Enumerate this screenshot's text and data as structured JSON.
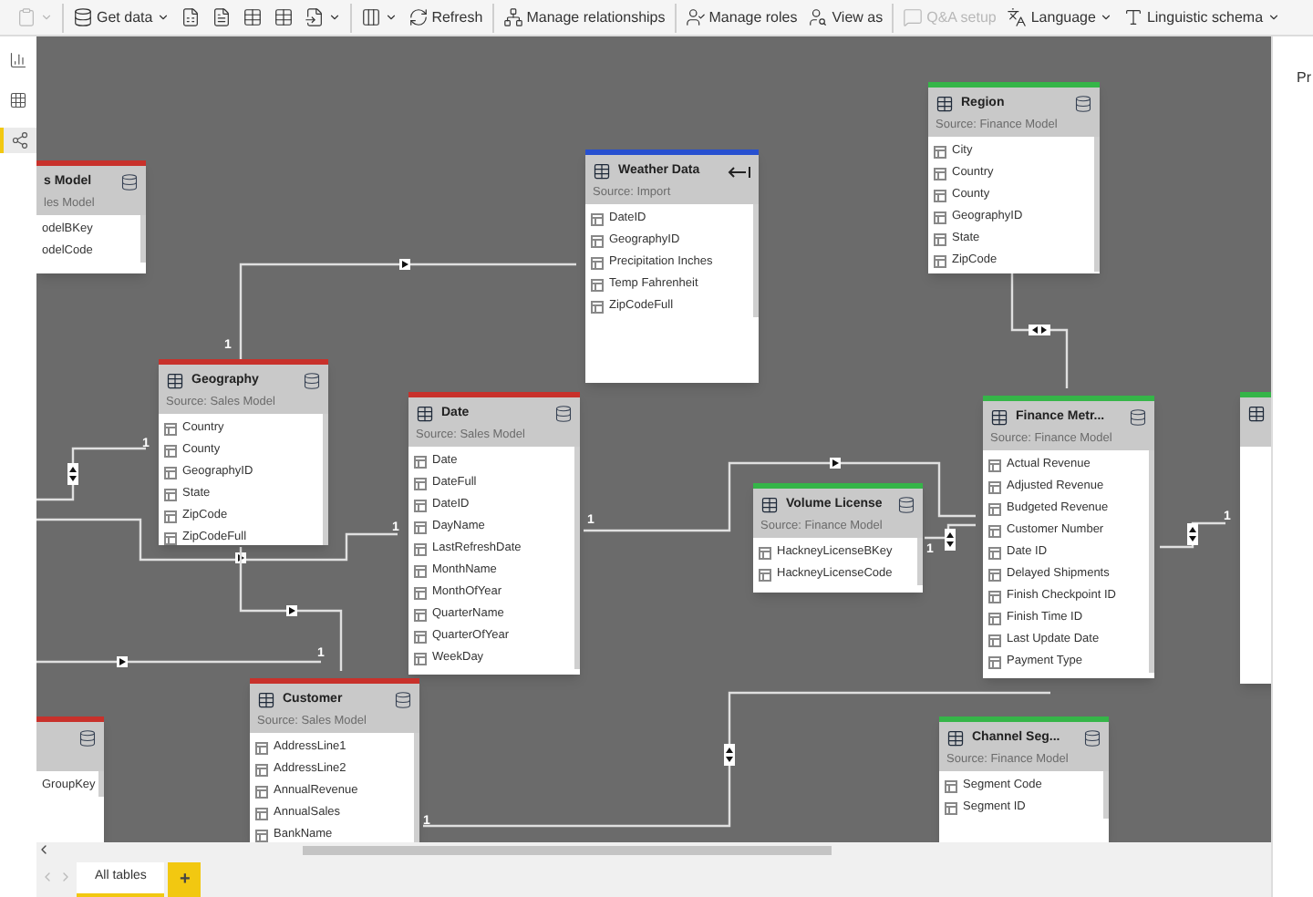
{
  "toolbar": {
    "groups": [
      [
        {
          "kind": "icon",
          "disabled": true,
          "menu": true
        }
      ],
      [
        {
          "kind": "text",
          "label": "Get data",
          "disabled": false,
          "menu": true
        },
        {
          "kind": "icon",
          "disabled": false,
          "menu": false
        },
        {
          "kind": "icon",
          "disabled": false,
          "menu": false
        },
        {
          "kind": "icon",
          "disabled": false,
          "menu": false
        },
        {
          "kind": "icon",
          "disabled": false,
          "menu": false
        },
        {
          "kind": "icon",
          "disabled": false,
          "menu": true
        }
      ],
      [
        {
          "kind": "icon",
          "disabled": false,
          "menu": true
        },
        {
          "kind": "text",
          "label": "Refresh",
          "disabled": false,
          "menu": false
        }
      ],
      [
        {
          "kind": "text",
          "label": "Manage relationships",
          "disabled": false,
          "menu": false
        }
      ],
      [
        {
          "kind": "text",
          "label": "Manage roles",
          "disabled": false,
          "menu": false
        },
        {
          "kind": "text",
          "label": "View as",
          "disabled": false,
          "menu": false
        }
      ],
      [
        {
          "kind": "text",
          "label": "Q&A setup",
          "disabled": true,
          "menu": false
        },
        {
          "kind": "text",
          "label": "Language",
          "disabled": false,
          "menu": true
        },
        {
          "kind": "text",
          "label": "Linguistic schema",
          "disabled": false,
          "menu": true
        }
      ]
    ]
  },
  "nav": [
    {
      "selected": false
    },
    {
      "selected": false
    },
    {
      "selected": true
    }
  ],
  "right_panel": {
    "title": "Pr"
  },
  "tables": [
    {
      "name": "s Model",
      "source": "les Model",
      "color": "#c8312b",
      "kind": "storage",
      "clipped": true,
      "rows": [
        "odelBKey",
        "odelCode"
      ]
    },
    {
      "name": "Weather Data",
      "source": "Source: Import",
      "color": "#2750d0",
      "kind": "import",
      "clipped": false,
      "rows": [
        "DateID",
        "GeographyID",
        "Precipitation Inches",
        "Temp Fahrenheit",
        "ZipCodeFull"
      ]
    },
    {
      "name": "Region",
      "source": "Source: Finance Model",
      "color": "#35b548",
      "kind": "storage",
      "clipped": false,
      "rows": [
        "City",
        "Country",
        "County",
        "GeographyID",
        "State",
        "ZipCode"
      ]
    },
    {
      "name": "Geography",
      "source": "Source: Sales Model",
      "color": "#c8312b",
      "kind": "storage",
      "clipped": false,
      "rows": [
        "Country",
        "County",
        "GeographyID",
        "State",
        "ZipCode",
        "ZipCodeFull"
      ]
    },
    {
      "name": "Date",
      "source": "Source: Sales Model",
      "color": "#c8312b",
      "kind": "storage",
      "clipped": false,
      "rows": [
        "Date",
        "DateFull",
        "DateID",
        "DayName",
        "LastRefreshDate",
        "MonthName",
        "MonthOfYear",
        "QuarterName",
        "QuarterOfYear",
        "WeekDay"
      ]
    },
    {
      "name": "Volume License",
      "source": "Source: Finance Model",
      "color": "#35b548",
      "kind": "storage",
      "clipped": false,
      "rows": [
        "HackneyLicenseBKey",
        "HackneyLicenseCode"
      ]
    },
    {
      "name": "Finance Metr...",
      "source": "Source: Finance Model",
      "color": "#35b548",
      "kind": "storage",
      "clipped": false,
      "rows": [
        "Actual Revenue",
        "Adjusted Revenue",
        "Budgeted Revenue",
        "Customer Number",
        "Date ID",
        "Delayed Shipments",
        "Finish Checkpoint ID",
        "Finish Time ID",
        "Last Update Date",
        "Payment Type"
      ]
    },
    {
      "color": "#35b548",
      "kind": "partial",
      "clipped": false
    },
    {
      "name": "Customer",
      "source": "Source: Sales Model",
      "color": "#c8312b",
      "kind": "storage",
      "clipped": false,
      "rows": [
        "AddressLine1",
        "AddressLine2",
        "AnnualRevenue",
        "AnnualSales",
        "BankName"
      ]
    },
    {
      "color": "#c8312b",
      "kind": "storage",
      "clipped": true,
      "rows": [
        "GroupKey"
      ]
    },
    {
      "name": "Channel Seg...",
      "source": "Source: Finance Model",
      "color": "#35b548",
      "kind": "storage",
      "clipped": false,
      "rows": [
        "Segment Code",
        "Segment ID"
      ]
    }
  ],
  "cardinality_labels": [
    "1",
    "1",
    "1",
    "1",
    "1",
    "1",
    "1",
    "1"
  ],
  "tabs": [
    {
      "label": "All tables",
      "selected": true
    }
  ],
  "add_tab": {
    "label": "+"
  }
}
